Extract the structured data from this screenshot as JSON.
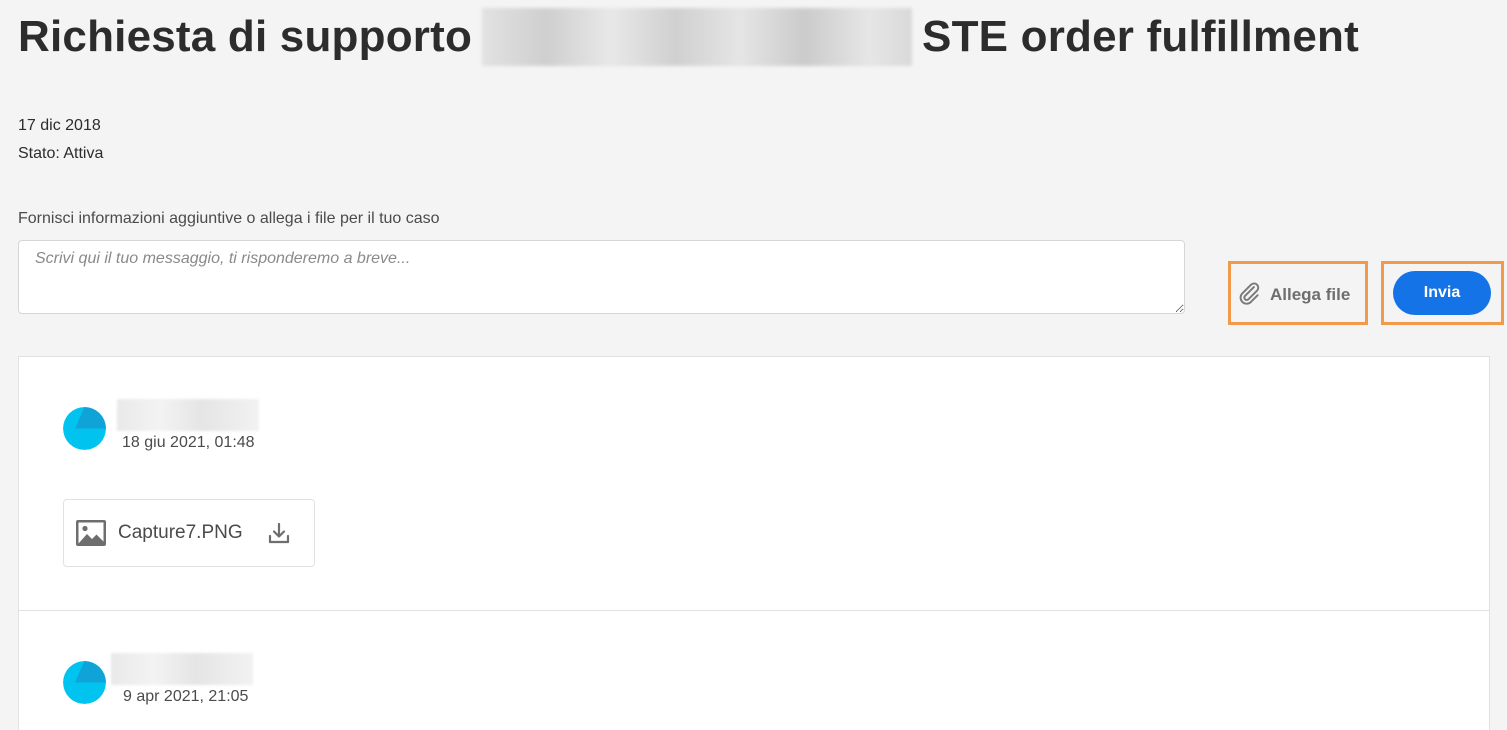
{
  "header": {
    "title_prefix": "Richiesta di supporto",
    "title_suffix": "STE order fulfillment"
  },
  "case": {
    "date": "17 dic 2018",
    "status": "Stato: Attiva"
  },
  "reply": {
    "instructions": "Fornisci informazioni aggiuntive o allega i file per il tuo caso",
    "placeholder": "Scrivi qui il tuo messaggio, ti risponderemo a breve...",
    "value": ""
  },
  "actions": {
    "attach_label": "Allega file",
    "send_label": "Invia"
  },
  "colors": {
    "accent": "#1473e6",
    "highlight_outline": "#f09a4a",
    "avatar": "#00c3f0"
  },
  "messages": [
    {
      "date": "18 giu 2021, 01:48",
      "attachment": {
        "name": "Capture7.PNG",
        "icon": "image-icon",
        "action_icon": "download-icon"
      }
    },
    {
      "date": "9 apr 2021, 21:05"
    }
  ]
}
